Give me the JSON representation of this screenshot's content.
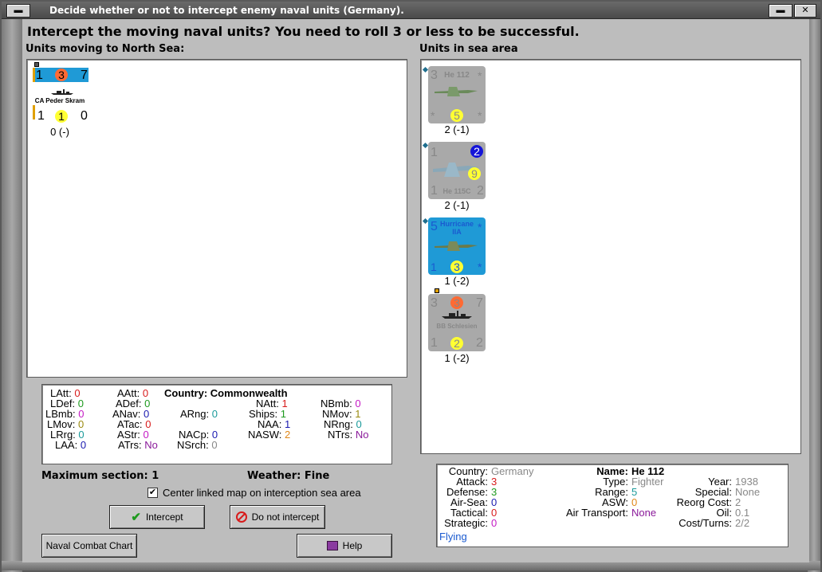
{
  "window": {
    "title": "Decide whether or not to intercept enemy naval units (Germany)."
  },
  "question": "Intercept the moving naval units?  You need to roll 3 or less to be successful.",
  "left_panel": {
    "header": "Units moving to North Sea:"
  },
  "right_panel": {
    "header": "Units in sea area"
  },
  "moving_units": [
    {
      "top_left": "1",
      "circle": "3",
      "top_right": "7",
      "name": "CA Peder Skram",
      "bot_left": "1",
      "bot_circle": "1",
      "bot_right": "0",
      "caption": "0 (-)"
    }
  ],
  "sea_units": [
    {
      "tl": "3",
      "name": "He 112",
      "tr": "*",
      "bl": "*",
      "circle": "5",
      "br": "*",
      "caption": "2 (-1)"
    },
    {
      "tl": "1",
      "tr_circle": "2",
      "mid_circle": "9",
      "name": "He 115C",
      "bl": "1",
      "br": "2",
      "caption": "2 (-1)"
    },
    {
      "tl": "5",
      "name": "Hurricane IIA",
      "tr": "*",
      "bl": "1",
      "circle": "3",
      "br": "*",
      "caption": "1 (-2)"
    },
    {
      "tl": "3",
      "circle_top": "3",
      "tr": "7",
      "name": "BB Schlesien",
      "bl": "1",
      "circle": "2",
      "br": "2",
      "caption": "1 (-2)"
    }
  ],
  "stats": {
    "country_label": "Country:",
    "country_value": "Commonwealth",
    "col1": [
      {
        "k": "LAtt:",
        "v": "0"
      },
      {
        "k": "LDef:",
        "v": "0"
      },
      {
        "k": "LBmb:",
        "v": "0"
      },
      {
        "k": "LMov:",
        "v": "0"
      },
      {
        "k": "LRrg:",
        "v": "0"
      },
      {
        "k": "LAA:",
        "v": "0"
      }
    ],
    "col2": [
      {
        "k": "AAtt:",
        "v": "0"
      },
      {
        "k": "ADef:",
        "v": "0"
      },
      {
        "k": "ANav:",
        "v": "0"
      },
      {
        "k": "ATac:",
        "v": "0"
      },
      {
        "k": "AStr:",
        "v": "0"
      },
      {
        "k": "ATrs:",
        "v": "No"
      }
    ],
    "col3": [
      {
        "k": "ARng:",
        "v": "0"
      },
      {
        "k": "NACp:",
        "v": "0"
      },
      {
        "k": "NSrch:",
        "v": "0"
      }
    ],
    "col4": [
      {
        "k": "NAtt:",
        "v": "1"
      },
      {
        "k": "Ships:",
        "v": "1"
      },
      {
        "k": "NAA:",
        "v": "1"
      },
      {
        "k": "NASW:",
        "v": "2"
      }
    ],
    "col5": [
      {
        "k": "NBmb:",
        "v": "0"
      },
      {
        "k": "NMov:",
        "v": "1"
      },
      {
        "k": "NRng:",
        "v": "0"
      },
      {
        "k": "NTrs:",
        "v": "No"
      }
    ]
  },
  "max_section": "Maximum section: 1",
  "weather": "Weather:  Fine",
  "center_checkbox": {
    "label": "Center linked map on interception sea area",
    "checked": "✔"
  },
  "buttons": {
    "intercept": "Intercept",
    "no_intercept": "Do not intercept",
    "naval_chart": "Naval Combat Chart",
    "help": "Help"
  },
  "unit_info": {
    "country_k": "Country:",
    "country_v": "Germany",
    "attack_k": "Attack:",
    "attack_v": "3",
    "defense_k": "Defense:",
    "defense_v": "3",
    "airsea_k": "Air-Sea:",
    "airsea_v": "0",
    "tactical_k": "Tactical:",
    "tactical_v": "0",
    "strategic_k": "Strategic:",
    "strategic_v": "0",
    "status": "Flying",
    "name_k": "Name:",
    "name_v": "He 112",
    "type_k": "Type:",
    "type_v": "Fighter",
    "range_k": "Range:",
    "range_v": "5",
    "asw_k": "ASW:",
    "asw_v": "0",
    "airtrans_k": "Air Transport:",
    "airtrans_v": "None",
    "year_k": "Year:",
    "year_v": "1938",
    "special_k": "Special:",
    "special_v": "None",
    "reorg_k": "Reorg Cost:",
    "reorg_v": "2",
    "oil_k": "Oil:",
    "oil_v": "0.1",
    "cost_k": "Cost/Turns:",
    "cost_v": "2/2"
  }
}
